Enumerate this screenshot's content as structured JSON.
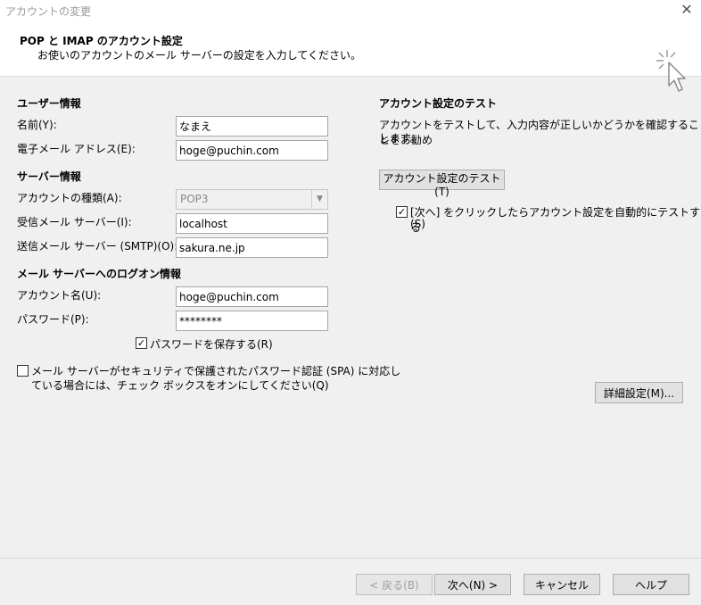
{
  "window": {
    "title": "アカウントの変更",
    "close_glyph": "✕"
  },
  "header": {
    "title": "POP と IMAP のアカウント設定",
    "subtitle": "お使いのアカウントのメール サーバーの設定を入力してください。"
  },
  "user_info": {
    "section": "ユーザー情報",
    "name_label": "名前(Y):",
    "name_value": "なまえ",
    "email_label": "電子メール アドレス(E):",
    "email_value": "hoge@puchin.com"
  },
  "server_info": {
    "section": "サーバー情報",
    "account_type_label": "アカウントの種類(A):",
    "account_type_value": "POP3",
    "incoming_label": "受信メール サーバー(I):",
    "incoming_value": "localhost",
    "outgoing_label": "送信メール サーバー (SMTP)(O):",
    "outgoing_value": "sakura.ne.jp"
  },
  "logon_info": {
    "section": "メール サーバーへのログオン情報",
    "account_name_label": "アカウント名(U):",
    "account_name_value": "hoge@puchin.com",
    "password_label": "パスワード(P):",
    "password_value": "********",
    "save_password_label": "パスワードを保存する(R)",
    "save_password_checked": true,
    "spa_label_line1": "メール サーバーがセキュリティで保護されたパスワード認証 (SPA) に対応し",
    "spa_label_line2": "ている場合には、チェック ボックスをオンにしてください(Q)",
    "spa_checked": false
  },
  "test": {
    "section": "アカウント設定のテスト",
    "description_line1": "アカウントをテストして、入力内容が正しいかどうかを確認することをお勧め",
    "description_line2": "します。",
    "test_button": "アカウント設定のテスト(T)",
    "auto_test_label_line1": "[次へ] をクリックしたらアカウント設定を自動的にテストする",
    "auto_test_label_line2": "(S)",
    "auto_test_checked": true
  },
  "more_settings_button": "詳細設定(M)...",
  "footer": {
    "back": "< 戻る(B)",
    "next": "次へ(N) >",
    "cancel": "キャンセル",
    "help": "ヘルプ"
  },
  "check_glyph": "✓",
  "dropdown_glyph": "▼"
}
